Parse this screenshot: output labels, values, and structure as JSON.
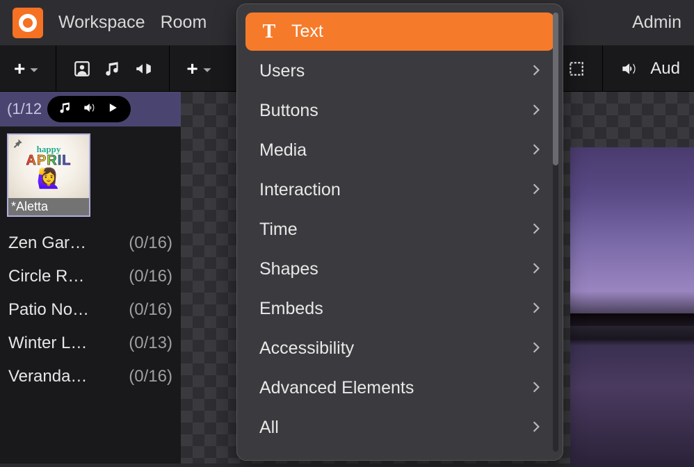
{
  "nav": {
    "workspace": "Workspace",
    "room": "Room",
    "admin": "Admin"
  },
  "toolbar": {
    "audio_label": "Aud"
  },
  "sidebar": {
    "count": "(1/12",
    "avatar_name": "*Aletta",
    "avatar_banner_top": "happy",
    "avatar_banner_main": "APRIL",
    "rooms": [
      {
        "name": "Zen Gar…",
        "count": "(0/16)"
      },
      {
        "name": "Circle R…",
        "count": "(0/16)"
      },
      {
        "name": "Patio No…",
        "count": "(0/16)"
      },
      {
        "name": "Winter L…",
        "count": "(0/13)"
      },
      {
        "name": "Veranda…",
        "count": "(0/16)"
      }
    ]
  },
  "dropdown": {
    "items": [
      {
        "label": "Text",
        "active": true,
        "submenu": false,
        "icon": "T"
      },
      {
        "label": "Users",
        "active": false,
        "submenu": true
      },
      {
        "label": "Buttons",
        "active": false,
        "submenu": true
      },
      {
        "label": "Media",
        "active": false,
        "submenu": true
      },
      {
        "label": "Interaction",
        "active": false,
        "submenu": true
      },
      {
        "label": "Time",
        "active": false,
        "submenu": true
      },
      {
        "label": "Shapes",
        "active": false,
        "submenu": true
      },
      {
        "label": "Embeds",
        "active": false,
        "submenu": true
      },
      {
        "label": "Accessibility",
        "active": false,
        "submenu": true
      },
      {
        "label": "Advanced Elements",
        "active": false,
        "submenu": true
      },
      {
        "label": "All",
        "active": false,
        "submenu": true
      }
    ]
  }
}
